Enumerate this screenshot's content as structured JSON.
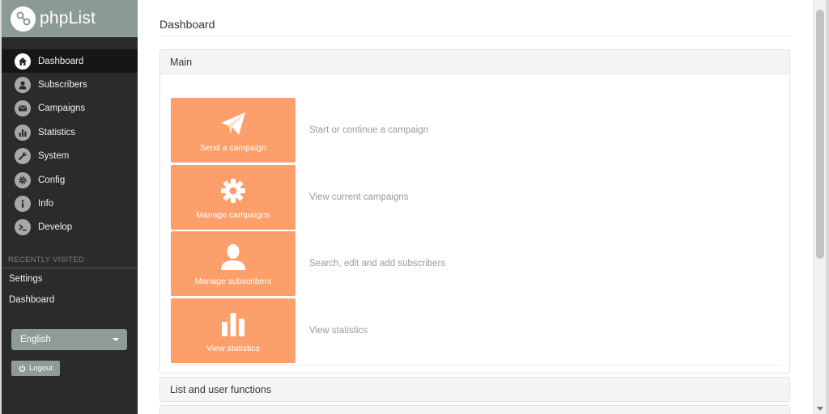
{
  "app": {
    "brand": "phpList"
  },
  "sidebar": {
    "items": [
      {
        "label": "Dashboard",
        "icon": "home-icon",
        "active": true
      },
      {
        "label": "Subscribers",
        "icon": "user-icon"
      },
      {
        "label": "Campaigns",
        "icon": "envelope-icon"
      },
      {
        "label": "Statistics",
        "icon": "bar-chart-icon"
      },
      {
        "label": "System",
        "icon": "wrench-icon"
      },
      {
        "label": "Config",
        "icon": "gear-icon"
      },
      {
        "label": "Info",
        "icon": "info-icon"
      },
      {
        "label": "Develop",
        "icon": "terminal-icon"
      }
    ],
    "recent_label": "RECENTLY VISITED",
    "recent": [
      {
        "label": "Settings"
      },
      {
        "label": "Dashboard"
      }
    ],
    "language": "English",
    "logout_label": "Logout"
  },
  "main": {
    "title": "Dashboard",
    "panel_main_title": "Main",
    "tiles": [
      {
        "label": "Send a campaign",
        "description": "Start or continue a campaign",
        "icon": "paper-plane-icon"
      },
      {
        "label": "Manage campaigns",
        "description": "View current campaigns",
        "icon": "gear-icon"
      },
      {
        "label": "Manage subscribers",
        "description": "Search, edit and add subscribers",
        "icon": "user-icon"
      },
      {
        "label": "View statistics",
        "description": "View statistics",
        "icon": "bar-chart-icon"
      }
    ],
    "panel_list_title": "List and user functions"
  },
  "colors": {
    "tile": "#fd9f6a",
    "sidebar": "#2b2b2b",
    "brand_bar": "#8b9a97"
  }
}
